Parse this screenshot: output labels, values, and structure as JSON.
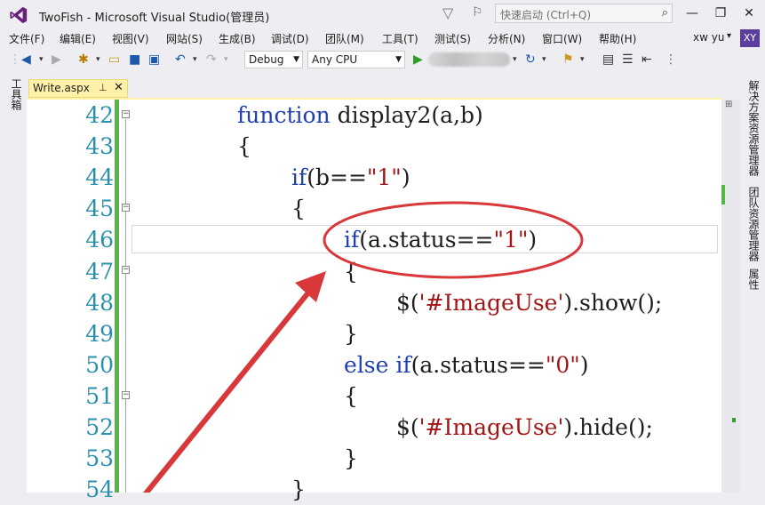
{
  "window": {
    "title": "TwoFish - Microsoft Visual Studio(管理员)",
    "quick_launch_placeholder": "快速启动 (Ctrl+Q)",
    "minimize": "—",
    "restore": "❐",
    "close": "✕"
  },
  "menu": [
    "文件(F)",
    "编辑(E)",
    "视图(V)",
    "网站(S)",
    "生成(B)",
    "调试(D)",
    "团队(M)",
    "工具(T)",
    "测试(S)",
    "分析(N)",
    "窗口(W)",
    "帮助(H)"
  ],
  "user": {
    "name": "xw yu",
    "initials": "XY",
    "avatar_color": "#5b3e9e"
  },
  "toolbar": {
    "configuration": "Debug",
    "platform": "Any CPU"
  },
  "left_panel": {
    "toolbox": "工具箱"
  },
  "right_panel": [
    "解决方案资源管理器",
    "团队资源管理器",
    "属性"
  ],
  "tab": {
    "label": "Write.aspx",
    "pin": "⊥",
    "close": "✕"
  },
  "editor": {
    "line_numbers": [
      "42",
      "43",
      "44",
      "45",
      "46",
      "47",
      "48",
      "49",
      "50",
      "51",
      "52",
      "53",
      "54"
    ],
    "lines": {
      "l42": {
        "kw": "function",
        "rest": " display2(a,b)"
      },
      "l43": "{",
      "l44": {
        "kw": "if",
        "rest": "(b==",
        "str": "\"1\"",
        "end": ")"
      },
      "l45": "{",
      "l46": {
        "kw": "if",
        "rest": "(a.status==",
        "str": "\"1\"",
        "end": ")"
      },
      "l47": "{",
      "l48": {
        "pre": "$(",
        "str": "'#ImageUse'",
        "end": ").show();"
      },
      "l49": "}",
      "l50": {
        "kw": "else",
        "sp": " ",
        "kw2": "if",
        "rest": "(a.status==",
        "str": "\"0\"",
        "end": ")"
      },
      "l51": "{",
      "l52": {
        "pre": "$(",
        "str": "'#ImageUse'",
        "end": ").hide();"
      },
      "l53": "}",
      "l54": "}"
    }
  },
  "colors": {
    "keyword": "#1f3fb0",
    "string": "#a31515",
    "line_number": "#2b91af",
    "annotation": "#d9383a",
    "change_bar": "#57b44b"
  }
}
